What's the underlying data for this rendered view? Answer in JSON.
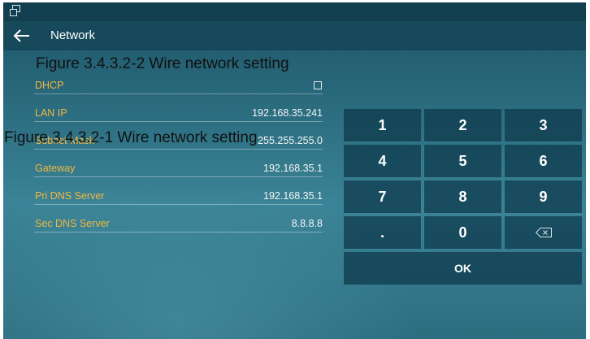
{
  "titlebar": {
    "title": "Network"
  },
  "captions": {
    "upper": "Figure 3.4.3.2-2 Wire network setting",
    "lower": "Figure 3.4.3.2-1 Wire network setting"
  },
  "fields": [
    {
      "label": "DHCP",
      "value": "",
      "checked": false
    },
    {
      "label": "LAN IP",
      "value": "192.168.35.241"
    },
    {
      "label": "Subnet Mask",
      "value": "255.255.255.0"
    },
    {
      "label": "Gateway",
      "value": "192.168.35.1"
    },
    {
      "label": "Pri DNS Server",
      "value": "192.168.35.1"
    },
    {
      "label": "Sec DNS Server",
      "value": "8.8.8.8"
    }
  ],
  "keypad": {
    "keys": [
      "1",
      "2",
      "3",
      "4",
      "5",
      "6",
      "7",
      "8",
      "9",
      ".",
      "0",
      "backspace"
    ],
    "ok_label": "OK"
  },
  "colors": {
    "label": "#f2b740",
    "value": "#f5f5f5",
    "key_bg": "#0c384a",
    "titlebar": "#16495a"
  }
}
